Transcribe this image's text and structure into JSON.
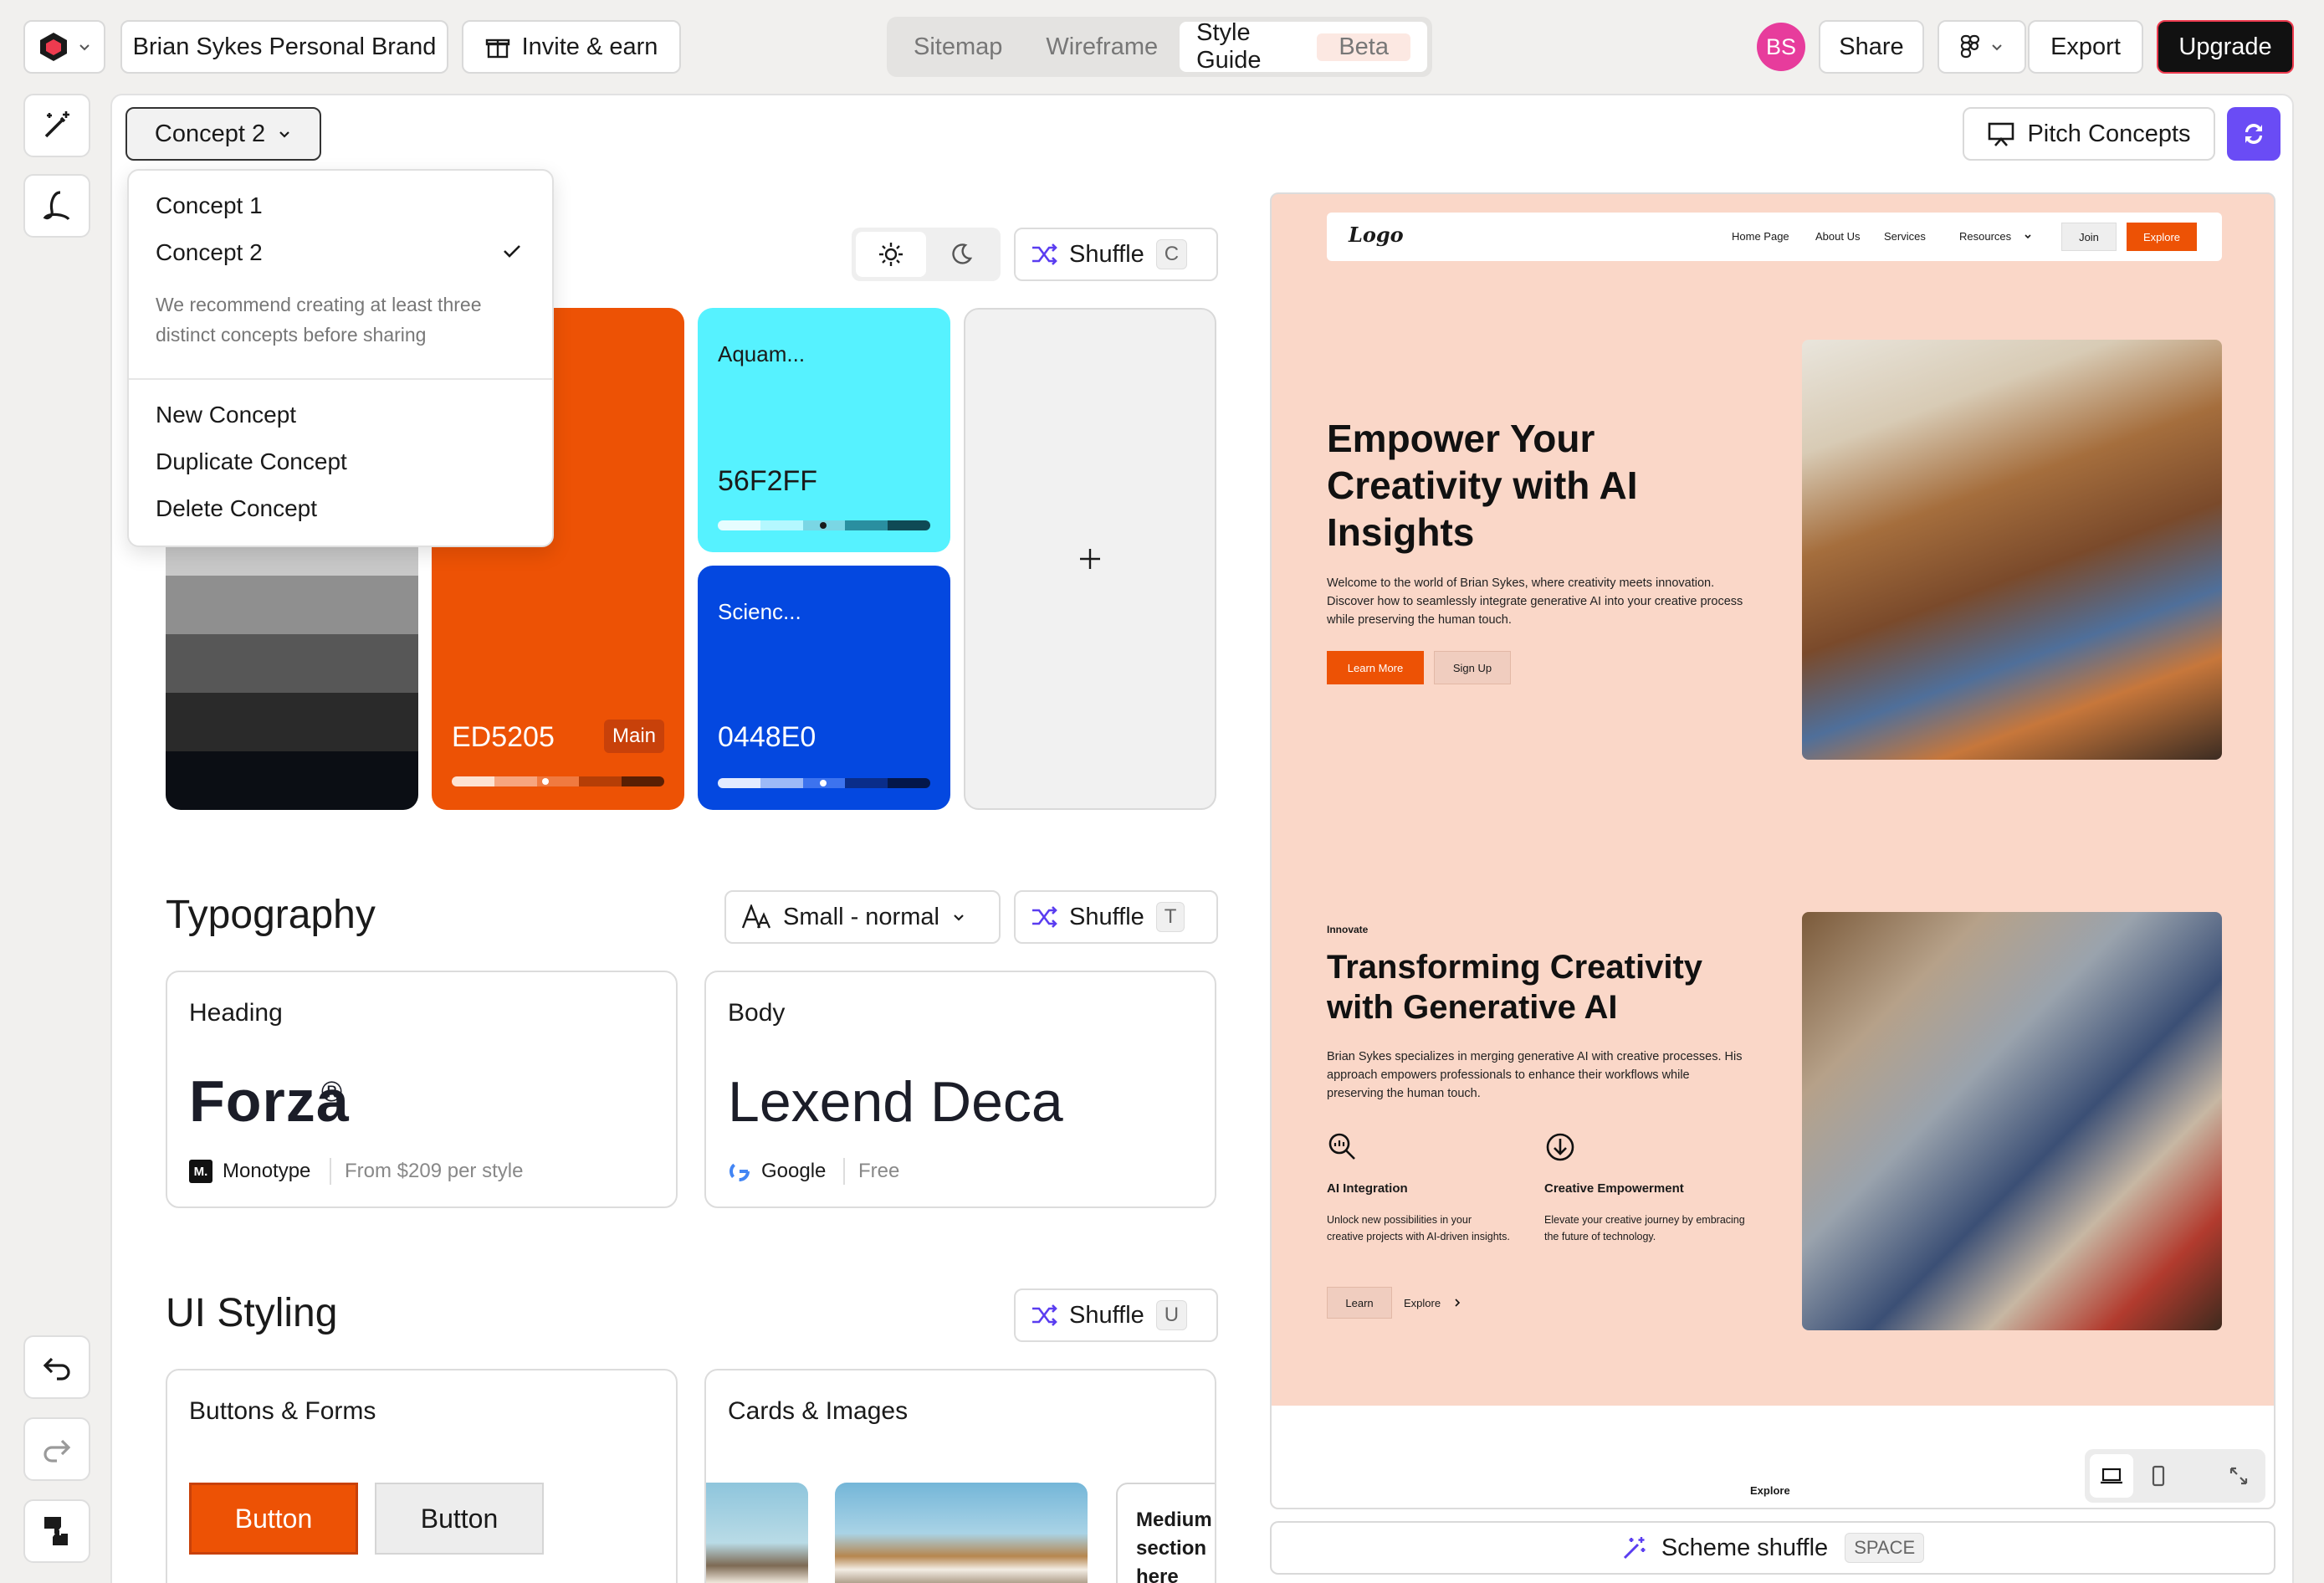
{
  "topbar": {
    "project_name": "Brian Sykes Personal Brand",
    "invite_label": "Invite & earn",
    "tabs": [
      {
        "label": "Sitemap"
      },
      {
        "label": "Wireframe"
      },
      {
        "label": "Style Guide",
        "badge": "Beta"
      }
    ],
    "avatar_initials": "BS",
    "share_label": "Share",
    "export_label": "Export",
    "upgrade_label": "Upgrade"
  },
  "toolbar": {
    "concept_select": "Concept 2",
    "pitch_label": "Pitch Concepts"
  },
  "concept_menu": {
    "items": [
      "Concept 1",
      "Concept 2"
    ],
    "selected": "Concept 2",
    "hint": "We recommend creating at least three distinct concepts before sharing",
    "actions": [
      "New Concept",
      "Duplicate Concept",
      "Delete Concept"
    ]
  },
  "colors": {
    "shuffle_label": "Shuffle",
    "shuffle_key": "C",
    "main_hex": "ED5205",
    "main_badge": "Main",
    "aqua_name": "Aquam...",
    "aqua_hex": "56F2FF",
    "science_name": "Scienc...",
    "science_hex": "0448E0",
    "accent": "#ED5205",
    "aqua": "#56F2FF",
    "science": "#0448E0"
  },
  "typography": {
    "title": "Typography",
    "size_select": "Small - normal",
    "shuffle_label": "Shuffle",
    "shuffle_key": "T",
    "heading_label": "Heading",
    "heading_font": "Forza",
    "heading_mark": "®",
    "heading_foundry": "Monotype",
    "heading_foundry_logo": "M.",
    "heading_price": "From $209 per style",
    "body_label": "Body",
    "body_font": "Lexend Deca",
    "body_foundry": "Google",
    "body_price": "Free"
  },
  "ui_styling": {
    "title": "UI Styling",
    "shuffle_label": "Shuffle",
    "shuffle_key": "U",
    "buttons_label": "Buttons & Forms",
    "button_primary": "Button",
    "button_secondary": "Button",
    "cards_label": "Cards & Images",
    "card_text": "Medium section here"
  },
  "preview": {
    "logo": "Logo",
    "nav": [
      "Home Page",
      "About Us",
      "Services",
      "Resources"
    ],
    "join": "Join",
    "explore_btn": "Explore",
    "hero_title": "Empower Your Creativity with AI Insights",
    "hero_text": "Welcome to the world of Brian Sykes, where creativity meets innovation. Discover how to seamlessly integrate generative AI into your creative process while preserving the human touch.",
    "learn_more": "Learn More",
    "sign_up": "Sign Up",
    "eyebrow": "Innovate",
    "section_title": "Transforming Creativity with Generative AI",
    "section_text": "Brian Sykes specializes in merging generative AI with creative processes. His approach empowers professionals to enhance their workflows while preserving the human touch.",
    "feature1_title": "AI Integration",
    "feature1_text": "Unlock new possibilities in your creative projects with AI-driven insights.",
    "feature2_title": "Creative Empowerment",
    "feature2_text": "Elevate your creative journey by embracing the future of technology.",
    "learn": "Learn",
    "explore_link": "Explore",
    "footer_label": "Explore",
    "bg": "#FAD7C8"
  },
  "scheme": {
    "label": "Scheme shuffle",
    "key": "SPACE"
  }
}
